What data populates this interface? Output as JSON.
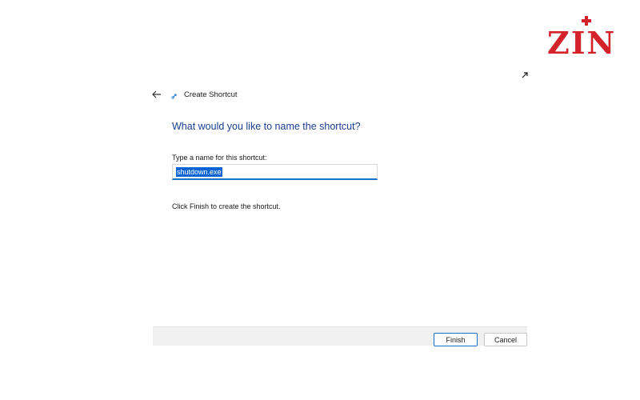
{
  "logo": {
    "text": "ZIN",
    "color": "#d3222a"
  },
  "dialog": {
    "title": "Create Shortcut",
    "back_icon": "back-arrow-icon",
    "wizard_icon": "shortcut-wizard-icon",
    "expand_icon": "expand-arrow-icon",
    "main_instruction": "What would you like to name the shortcut?",
    "field_label": "Type a name for this shortcut:",
    "name_value": "shutdown.exe",
    "hint": "Click Finish to create the shortcut.",
    "accent_color": "#1f6fc9",
    "heading_color": "#1a3d8f"
  },
  "footer": {
    "finish_label": "Finish",
    "cancel_label": "Cancel"
  }
}
